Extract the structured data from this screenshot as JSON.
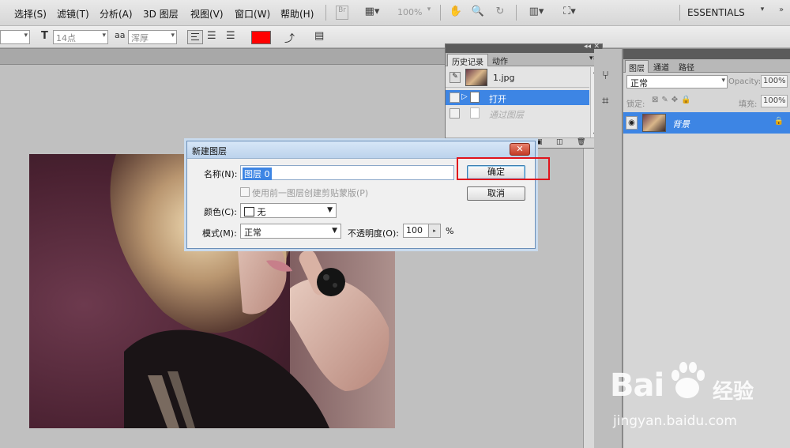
{
  "menubar": {
    "items": [
      "选择(S)",
      "滤镜(T)",
      "分析(A)",
      "3D 图层",
      "视图(V)",
      "窗口(W)",
      "帮助(H)"
    ],
    "zoom": "100%",
    "workspace": "ESSENTIALS"
  },
  "options": {
    "font_size": "14点",
    "aa_label": "aa",
    "antialias": "浑厚",
    "text_color": "#ff0000"
  },
  "history_panel": {
    "tabs": [
      "历史记录",
      "动作"
    ],
    "snapshot": "1.jpg",
    "steps": [
      {
        "label": "打开",
        "selected": true
      },
      {
        "label": "通过图层",
        "selected": false
      }
    ]
  },
  "layers_panel": {
    "tabs": [
      "图层",
      "通道",
      "路径"
    ],
    "blend_mode": "正常",
    "opacity_label": "Opacity:",
    "opacity": "100%",
    "lock_label": "锁定:",
    "fill_label": "填充:",
    "fill": "100%",
    "layer_name": "背景"
  },
  "dialog": {
    "title": "新建图层",
    "name_label": "名称(N):",
    "name_value": "图层 0",
    "clip_label": "使用前一图层创建剪贴蒙版(P)",
    "color_label": "颜色(C):",
    "color_value": "无",
    "mode_label": "模式(M):",
    "mode_value": "正常",
    "opacity_label": "不透明度(O):",
    "opacity_value": "100",
    "opacity_unit": "%",
    "ok_label": "确定",
    "cancel_label": "取消"
  },
  "watermark": {
    "brand_left": "Bai",
    "brand_right": "经验",
    "url": "jingyan.baidu.com"
  }
}
